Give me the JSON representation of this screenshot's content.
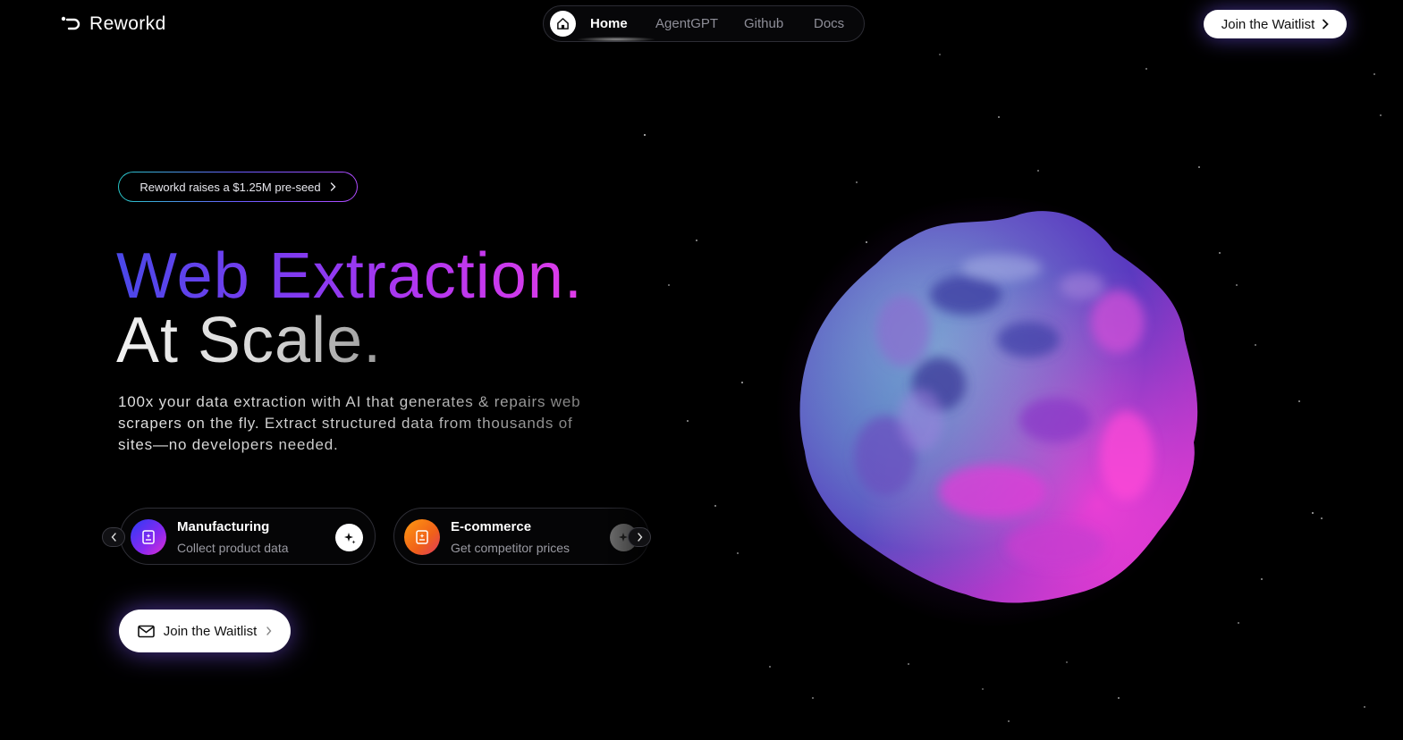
{
  "brand": {
    "name": "Reworkd"
  },
  "nav": {
    "items": [
      {
        "label": "Home",
        "active": true
      },
      {
        "label": "AgentGPT",
        "active": false
      },
      {
        "label": "Github",
        "active": false
      },
      {
        "label": "Docs",
        "active": false
      }
    ]
  },
  "header_cta": {
    "label": "Join the Waitlist"
  },
  "badge": {
    "label": "Reworkd raises a $1.25M pre-seed"
  },
  "hero": {
    "line1": "Web Extraction.",
    "line2": "At Scale.",
    "description": "100x your data extraction with AI that generates & repairs web scrapers on the fly. Extract structured data from thousands of sites—no developers needed."
  },
  "use_cases": [
    {
      "title": "Manufacturing",
      "subtitle": "Collect product data",
      "icon": "product-data-icon",
      "action_icon": "sparkle-icon"
    },
    {
      "title": "E-commerce",
      "subtitle": "Get competitor prices",
      "icon": "price-tag-icon",
      "action_icon": "sparkle-icon"
    }
  ],
  "main_cta": {
    "label": "Join the Waitlist",
    "icon": "mail-icon"
  },
  "colors": {
    "background": "#000000",
    "accent_blue": "#4a48e8",
    "accent_purple": "#b236f0",
    "accent_pink": "#e03ce8",
    "manufacturing_icon_bg": "#4b2cf0",
    "ecommerce_icon_bg": "#f07a1a"
  }
}
